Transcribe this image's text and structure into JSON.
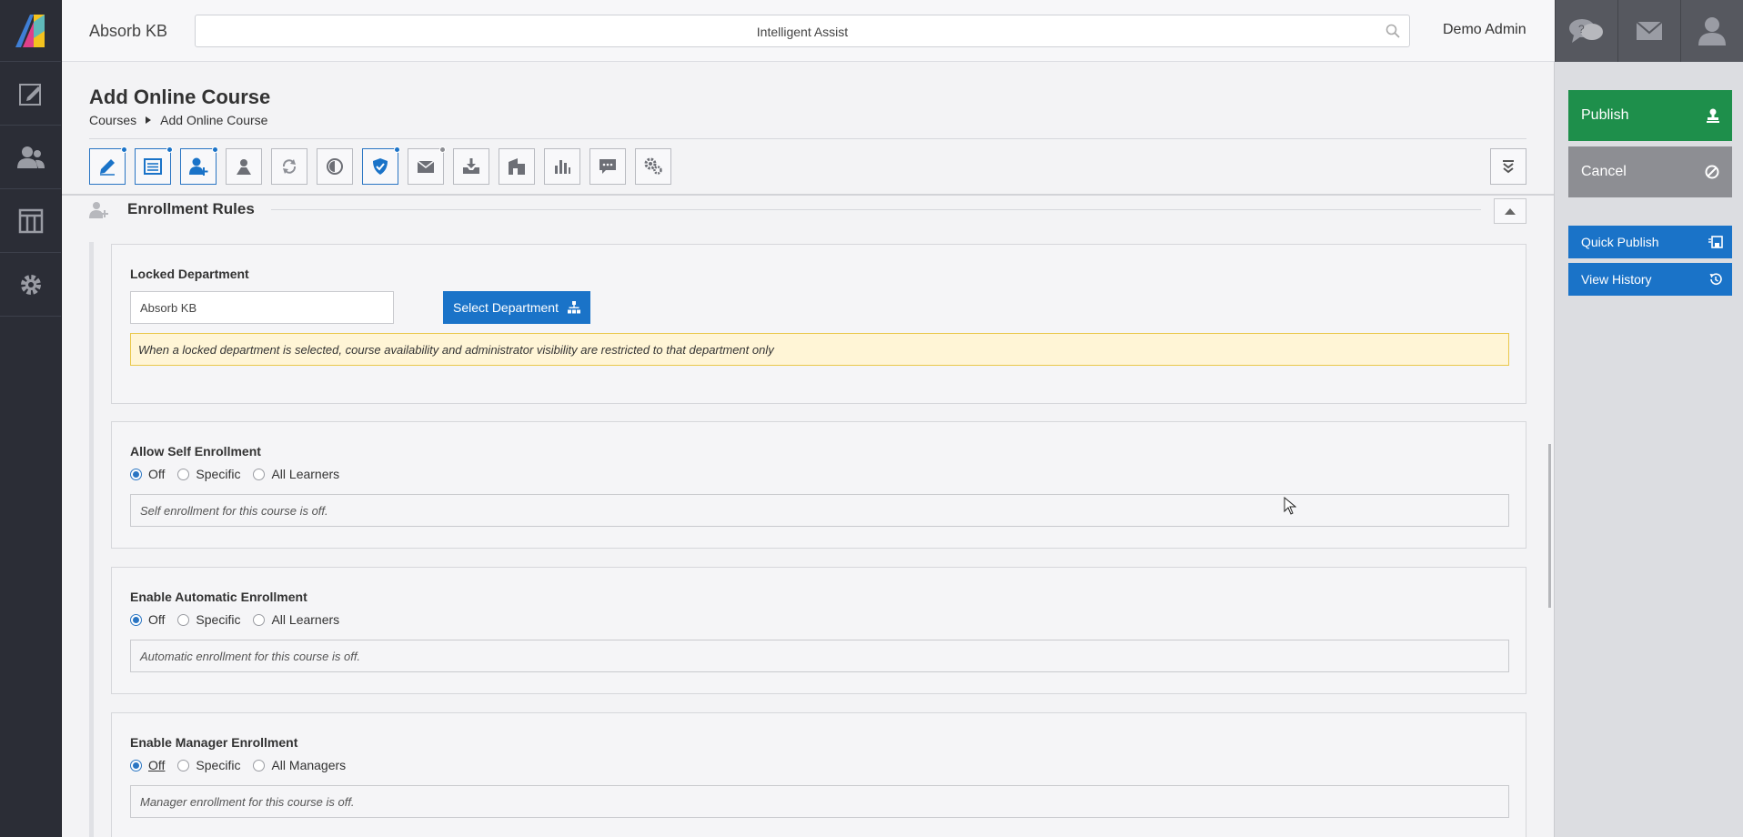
{
  "app": {
    "brand": "Absorb KB",
    "search_placeholder": "Intelligent Assist",
    "user_name": "Demo Admin"
  },
  "leftnav": {
    "items": [
      {
        "icon": "edit-icon"
      },
      {
        "icon": "users-icon"
      },
      {
        "icon": "columns-icon"
      },
      {
        "icon": "gear-icon"
      }
    ]
  },
  "topicons": [
    "chat-icon",
    "mail-icon",
    "user-profile-icon"
  ],
  "page": {
    "title": "Add Online Course",
    "breadcrumb": [
      "Courses",
      "Add Online Course"
    ]
  },
  "toolbar": {
    "buttons": [
      {
        "icon": "pencil-icon",
        "active": true,
        "dot": "blue"
      },
      {
        "icon": "list-icon",
        "active": true,
        "dot": "blue"
      },
      {
        "icon": "user-add-icon",
        "active": true,
        "dot": "blue"
      },
      {
        "icon": "profile-icon",
        "active": false
      },
      {
        "icon": "refresh-icon",
        "active": false
      },
      {
        "icon": "contrast-icon",
        "active": false
      },
      {
        "icon": "shield-icon",
        "active": true,
        "dot": "blue"
      },
      {
        "icon": "envelope-icon",
        "active": false,
        "dot": "grey"
      },
      {
        "icon": "download-icon",
        "active": false
      },
      {
        "icon": "building-icon",
        "active": false
      },
      {
        "icon": "bar-chart-icon",
        "active": false
      },
      {
        "icon": "comment-icon",
        "active": false
      },
      {
        "icon": "settings-icon",
        "active": false
      }
    ]
  },
  "section": {
    "title": "Enrollment Rules"
  },
  "locked_department": {
    "title": "Locked Department",
    "value": "Absorb KB",
    "button_label": "Select Department",
    "warning": "When a locked department is selected, course availability and administrator visibility are restricted to that department only"
  },
  "self_enrollment": {
    "title": "Allow Self Enrollment",
    "options": [
      "Off",
      "Specific",
      "All Learners"
    ],
    "selected": "Off",
    "info": "Self enrollment for this course is off."
  },
  "auto_enrollment": {
    "title": "Enable Automatic Enrollment",
    "options": [
      "Off",
      "Specific",
      "All Learners"
    ],
    "selected": "Off",
    "info": "Automatic enrollment for this course is off."
  },
  "manager_enrollment": {
    "title": "Enable Manager Enrollment",
    "options": [
      "Off",
      "Specific",
      "All Managers"
    ],
    "selected": "Off",
    "info": "Manager enrollment for this course is off."
  },
  "actions": {
    "publish": "Publish",
    "cancel": "Cancel",
    "quick_publish": "Quick Publish",
    "view_history": "View History"
  },
  "colors": {
    "publish": "#1e8f4b",
    "cancel": "#8d8e93",
    "primary": "#1a73c8",
    "nav": "#2b2d36"
  }
}
